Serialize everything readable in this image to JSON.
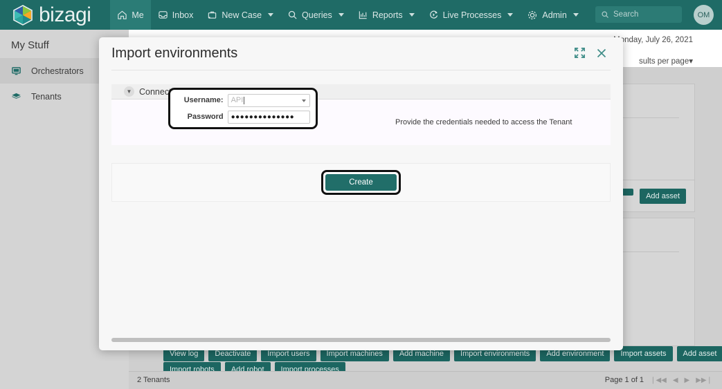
{
  "topnav": {
    "brand": "bizagi",
    "items": [
      {
        "label": "Me",
        "icon": "home-icon",
        "caret": false,
        "active": true
      },
      {
        "label": "Inbox",
        "icon": "inbox-icon",
        "caret": false,
        "active": false
      },
      {
        "label": "New Case",
        "icon": "briefcase-plus-icon",
        "caret": true,
        "active": false
      },
      {
        "label": "Queries",
        "icon": "search-icon",
        "caret": true,
        "active": false
      },
      {
        "label": "Reports",
        "icon": "chart-icon",
        "caret": true,
        "active": false
      },
      {
        "label": "Live Processes",
        "icon": "live-process-icon",
        "caret": true,
        "active": false
      },
      {
        "label": "Admin",
        "icon": "gear-icon",
        "caret": true,
        "active": false
      }
    ],
    "search_placeholder": "Search",
    "avatar_initials": "OM",
    "accent_color": "#1f6b66",
    "active_tab_color": "#2b7c76"
  },
  "sidebar": {
    "title": "My Stuff",
    "items": [
      {
        "label": "Orchestrators",
        "icon": "monitor-icon",
        "active": true
      },
      {
        "label": "Tenants",
        "icon": "layers-icon",
        "active": false
      }
    ]
  },
  "page": {
    "date": "Monday, July 26, 2021",
    "results_per_page": "sults per page",
    "toolbar_row1": [
      "View log",
      "Deactivate",
      "Import users",
      "Import machines",
      "Add machine",
      "Import environments",
      "Add environment",
      "Import assets",
      "Add asset"
    ],
    "toolbar_row2": [
      "Import robots",
      "Add robot",
      "Import processes"
    ],
    "card_buttons": [
      "Add asset",
      "Add asset"
    ],
    "footer_count": "2 Tenants",
    "pager_label": "Page 1 of 1",
    "pager_first": "❘◀◀",
    "pager_prev": "◀",
    "pager_next": "▶",
    "pager_last": "▶▶❘"
  },
  "modal": {
    "title": "Import environments",
    "expand_icon": "expand-icon",
    "close_icon": "close-icon",
    "section": {
      "title": "Connection settings",
      "chevron": "▼",
      "username_label": "Username:",
      "username_placeholder": "API",
      "username_value": "",
      "password_label": "Password",
      "password_value": "●●●●●●●●●●●●●●",
      "hint": "Provide the credentials needed to access the Tenant"
    },
    "create_label": "Create",
    "button_color": "#216e69"
  }
}
